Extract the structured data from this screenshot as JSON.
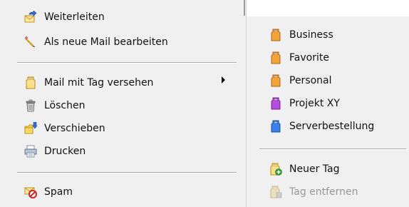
{
  "context_menu": {
    "items": [
      {
        "label": "Weiterleiten",
        "icon": "forward-mail-icon"
      },
      {
        "label": "Als neue Mail bearbeiten",
        "icon": "pencil-icon"
      },
      {
        "label": "Mail mit Tag versehen",
        "icon": "tag-icon",
        "has_submenu": true
      },
      {
        "label": "Löschen",
        "icon": "trash-icon"
      },
      {
        "label": "Verschieben",
        "icon": "move-folder-icon"
      },
      {
        "label": "Drucken",
        "icon": "printer-icon"
      },
      {
        "label": "Spam",
        "icon": "spam-icon"
      }
    ]
  },
  "tag_submenu": {
    "tags": [
      {
        "label": "Business",
        "color": "#f2a33a"
      },
      {
        "label": "Favorite",
        "color": "#f2a33a"
      },
      {
        "label": "Personal",
        "color": "#f2a33a"
      },
      {
        "label": "Projekt XY",
        "color": "#b44de0"
      },
      {
        "label": "Serverbestellung",
        "color": "#3a80e8"
      }
    ],
    "actions": [
      {
        "label": "Neuer Tag",
        "icon": "add-tag-icon",
        "enabled": true
      },
      {
        "label": "Tag entfernen",
        "icon": "remove-tag-icon",
        "enabled": false
      }
    ]
  }
}
